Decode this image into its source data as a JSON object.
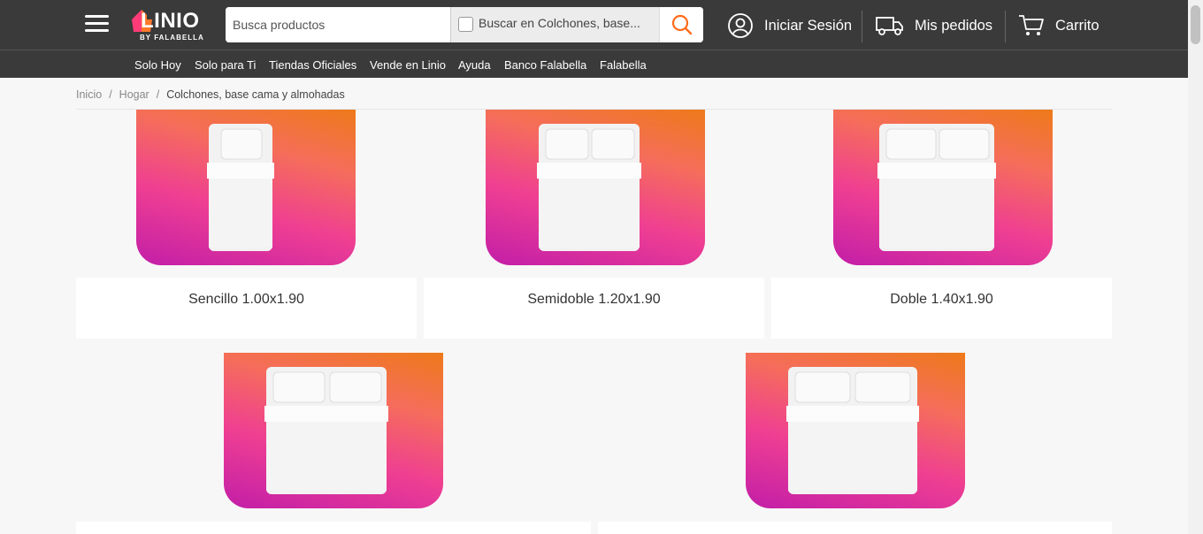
{
  "header": {
    "menu_icon": "hamburger-menu-icon",
    "logo_text": "LINIO",
    "logo_sub": "BY FALABELLA",
    "search_placeholder": "Busca productos",
    "scope_label": "Buscar en Colchones, base...",
    "login_label": "Iniciar Sesión",
    "orders_label": "Mis pedidos",
    "cart_label": "Carrito",
    "accent_color": "#ff6b1a"
  },
  "nav": {
    "items": [
      "Solo Hoy",
      "Solo para Ti",
      "Tiendas Oficiales",
      "Vende en Linio",
      "Ayuda",
      "Banco Falabella",
      "Falabella"
    ]
  },
  "breadcrumb": {
    "items": [
      "Inicio",
      "Hogar"
    ],
    "current": "Colchones, base cama y almohadas"
  },
  "categories": [
    {
      "label": "Sencillo 1.00x1.90",
      "bed": "single"
    },
    {
      "label": "Semidoble 1.20x1.90",
      "bed": "double"
    },
    {
      "label": "Doble 1.40x1.90",
      "bed": "double"
    },
    {
      "label": "",
      "bed": "double"
    },
    {
      "label": "",
      "bed": "double"
    }
  ]
}
